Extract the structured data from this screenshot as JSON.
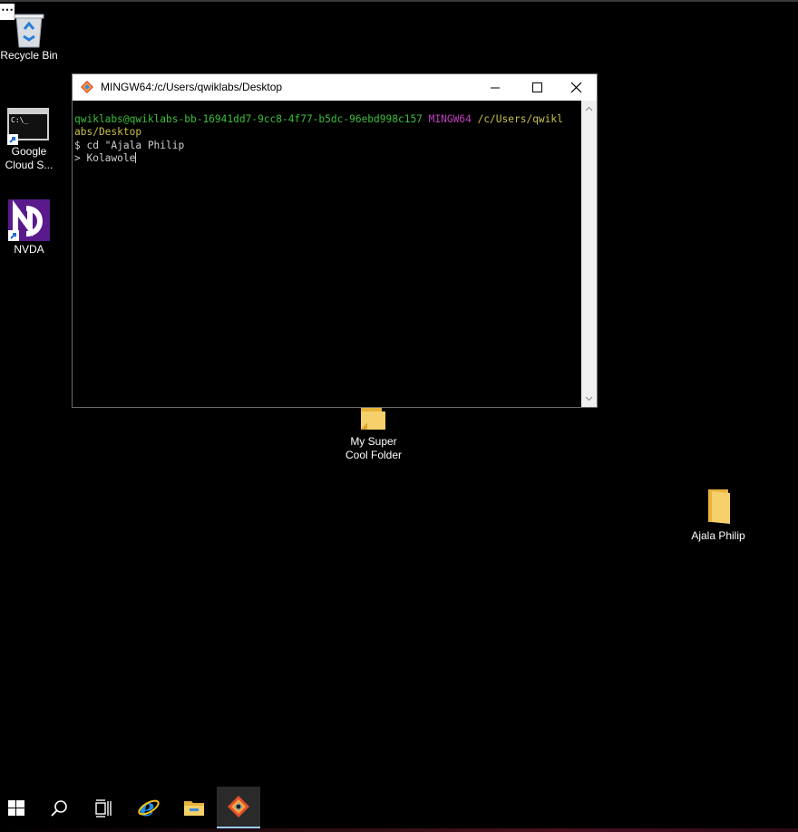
{
  "desktop": {
    "icons": [
      {
        "label": "Recycle Bin",
        "icon": "recycle-bin-icon"
      },
      {
        "label_line1": "Google",
        "label_line2": "Cloud S...",
        "icon": "terminal-shortcut-icon"
      },
      {
        "label": "NVDA",
        "icon": "nvda-icon"
      },
      {
        "label_line1": "My Super",
        "label_line2": "Cool Folder",
        "icon": "folder-icon"
      },
      {
        "label": "Ajala Philip",
        "icon": "folder-icon"
      }
    ]
  },
  "window": {
    "title": "MINGW64:/c/Users/qwiklabs/Desktop",
    "terminal": {
      "prompt_user": "qwiklabs@qwiklabs-bb-16941dd7-9cc8-4f77-b5dc-96ebd998c157",
      "prompt_env": "MINGW64",
      "prompt_path_line1": "/c/Users/qwikl",
      "prompt_path_line2": "abs/Desktop",
      "command_line": "$ cd \"Ajala Philip",
      "continuation_line": "> Kolawole"
    }
  },
  "taskbar": {
    "items": [
      "start-button",
      "search-button",
      "task-view-button",
      "internet-explorer",
      "file-explorer",
      "git-bash"
    ],
    "active": "git-bash"
  },
  "colors": {
    "prompt_user": "#3bbf3b",
    "prompt_env": "#c13fc1",
    "prompt_path": "#c8c14a",
    "taskbar_active_underline": "#9cc9f5"
  }
}
